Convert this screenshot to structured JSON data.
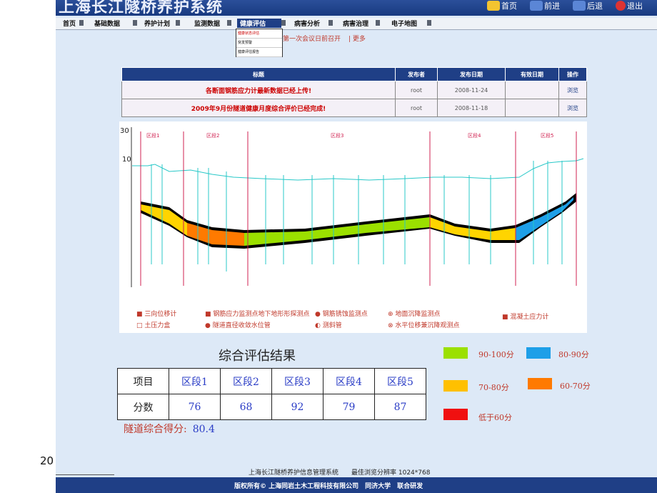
{
  "header": {
    "title": "上海长江隧桥养护系统",
    "buttons": [
      {
        "label": "首页",
        "icon": "home-icon"
      },
      {
        "label": "前进",
        "icon": "forward-icon"
      },
      {
        "label": "后退",
        "icon": "back-icon"
      },
      {
        "label": "退出",
        "icon": "exit-icon"
      }
    ]
  },
  "nav": {
    "items": [
      "首页",
      "基础数据",
      "养护计划",
      "监测数据",
      "健康评估",
      "病害分析",
      "病害治理",
      "电子地图"
    ],
    "active": "健康评估"
  },
  "dropdown": {
    "items": [
      "健康状态评估",
      "突发预警",
      "健康评估报告"
    ]
  },
  "notice": {
    "text": "第一次会议日前召开",
    "more": "更多"
  },
  "announcements": {
    "headers": [
      "标题",
      "发布者",
      "发布日期",
      "有效日期",
      "操作"
    ],
    "rows": [
      {
        "title": "各断面钢筋应力计最新数据已经上传!",
        "publisher": "root",
        "date": "2008-11-24",
        "valid": "",
        "action": "浏览"
      },
      {
        "title": "2009年9月份隧道健康月度综合评价已经完成!",
        "publisher": "root",
        "date": "2008-11-18",
        "valid": "",
        "action": "浏览"
      }
    ]
  },
  "diagram": {
    "y_labels": [
      "30",
      "10"
    ],
    "sections": [
      "区段1",
      "区段2",
      "区段3",
      "区段4",
      "区段5"
    ],
    "legend": [
      {
        "symbol": "■",
        "label": "三向位移计"
      },
      {
        "symbol": "■",
        "label": "钢筋应力监测点"
      },
      {
        "symbol": "■",
        "label": "地下地形形探测点"
      },
      {
        "symbol": "●",
        "label": "钢筋锈蚀监测点"
      },
      {
        "symbol": "⊕",
        "label": "地面沉降监测点"
      },
      {
        "symbol": "■",
        "label": "混凝土应力计"
      },
      {
        "symbol": "□",
        "label": "土压力盒"
      },
      {
        "symbol": "●",
        "label": "隧道直径收敛水位管"
      },
      {
        "symbol": "◐",
        "label": "测斜管"
      },
      {
        "symbol": "⊗",
        "label": "水平位移兼沉降观测点"
      }
    ],
    "colors": {
      "yellow": "#ffd400",
      "orange": "#ff7a00",
      "green": "#9be000",
      "blue": "#1e9fe8"
    }
  },
  "results": {
    "title": "综合评估结果",
    "row_header": "项目",
    "score_header": "分数",
    "sections": [
      "区段1",
      "区段2",
      "区段3",
      "区段4",
      "区段5"
    ],
    "scores": [
      "76",
      "68",
      "92",
      "79",
      "87"
    ],
    "total_label": "隧道综合得分:",
    "total_value": "80.4"
  },
  "legend": [
    {
      "label": "90-100分",
      "color": "#9be000"
    },
    {
      "label": "80-90分",
      "color": "#1e9fe8"
    },
    {
      "label": "70-80分",
      "color": "#ffc000"
    },
    {
      "label": "60-70分",
      "color": "#ff7a00"
    },
    {
      "label": "低于60分",
      "color": "#f01010"
    }
  ],
  "footer": {
    "line1": "上海长江隧桥养护信息管理系统　　最佳浏览分辨率 1024*768",
    "line2": "版权所有© 上海同岩土木工程科技有限公司　同济大学　联合研发"
  },
  "page_number": "20"
}
